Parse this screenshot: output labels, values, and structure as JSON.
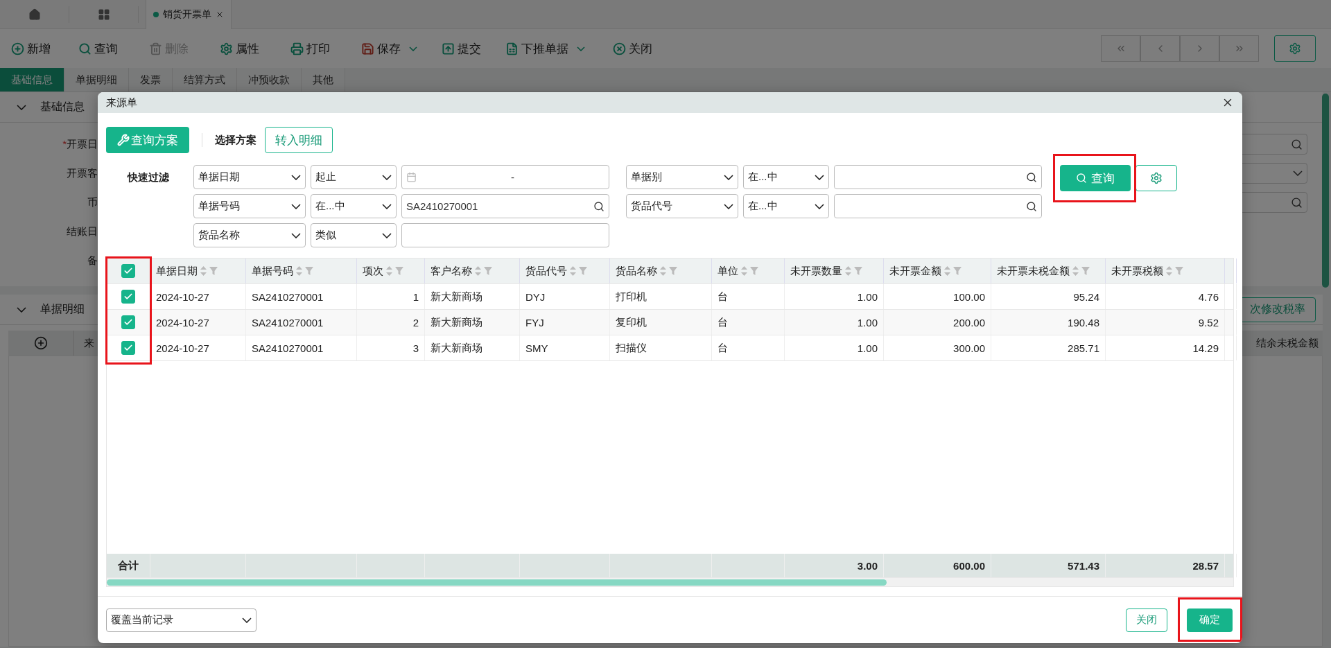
{
  "app_tabs": [
    {
      "label": "销货开票单",
      "selected": true
    }
  ],
  "toolbar": [
    {
      "label": "新增",
      "disabled": false,
      "has_menu": false
    },
    {
      "label": "查询",
      "disabled": false,
      "has_menu": false
    },
    {
      "label": "删除",
      "disabled": true,
      "has_menu": false
    },
    {
      "label": "属性",
      "disabled": false,
      "has_menu": false
    },
    {
      "label": "打印",
      "disabled": false,
      "has_menu": false
    },
    {
      "label": "保存",
      "disabled": false,
      "has_menu": true
    },
    {
      "label": "提交",
      "disabled": false,
      "has_menu": false
    },
    {
      "label": "下推单据",
      "disabled": false,
      "has_menu": true
    },
    {
      "label": "关闭",
      "disabled": false,
      "has_menu": false
    }
  ],
  "form_tabs": [
    {
      "label": "基础信息",
      "selected": true
    },
    {
      "label": "单据明细",
      "selected": false
    },
    {
      "label": "发票",
      "selected": false
    },
    {
      "label": "结算方式",
      "selected": false
    },
    {
      "label": "冲预收款",
      "selected": false
    },
    {
      "label": "其他",
      "selected": false
    }
  ],
  "basic_section": {
    "title": "基础信息",
    "expanded": true,
    "fields": [
      {
        "label": "开票日",
        "marker": "*",
        "kind": "search"
      },
      {
        "label": "开票客",
        "kind": "select"
      },
      {
        "label": "币",
        "kind": "search"
      },
      {
        "label": "结账日",
        "kind": "plain"
      },
      {
        "label": "备",
        "kind": "plain"
      }
    ]
  },
  "detail_section": {
    "title": "单据明细",
    "expanded": true,
    "button": "次修改税率",
    "columns": [
      "来",
      "结余未税金额"
    ]
  },
  "dialog": {
    "title": "来源单",
    "scheme_button": "查询方案",
    "scheme_label": "选择方案",
    "transfer_button": "转入明细",
    "quick_filter_label": "快速过滤",
    "filters": [
      {
        "field": "单据日期",
        "operator": "起止",
        "kind": "date",
        "separator": "-"
      },
      {
        "field": "单据别",
        "operator": "在...中",
        "kind": "search"
      },
      {
        "field": "单据号码",
        "operator": "在...中",
        "kind": "search",
        "value": "SA2410270001"
      },
      {
        "field": "货品代号",
        "operator": "在...中",
        "kind": "search"
      },
      {
        "field": "货品名称",
        "operator": "类似",
        "kind": "text"
      }
    ],
    "query_button": "查询",
    "table": {
      "select_all": true,
      "columns": [
        {
          "label": "单据日期",
          "kind": "text"
        },
        {
          "label": "单据号码",
          "kind": "text"
        },
        {
          "label": "项次",
          "kind": "number"
        },
        {
          "label": "客户名称",
          "kind": "text"
        },
        {
          "label": "货品代号",
          "kind": "text"
        },
        {
          "label": "货品名称",
          "kind": "text"
        },
        {
          "label": "单位",
          "kind": "text"
        },
        {
          "label": "未开票数量",
          "kind": "number",
          "total": "3.00"
        },
        {
          "label": "未开票金额",
          "kind": "number",
          "total": "600.00"
        },
        {
          "label": "未开票未税金额",
          "kind": "number",
          "total": "571.43"
        },
        {
          "label": "未开票税额",
          "kind": "number",
          "total": "28.57"
        }
      ],
      "rows": [
        {
          "checked": true,
          "cells": [
            "2024-10-27",
            "SA2410270001",
            "1",
            "新大新商场",
            "DYJ",
            "打印机",
            "台",
            "1.00",
            "100.00",
            "95.24",
            "4.76"
          ]
        },
        {
          "checked": true,
          "cells": [
            "2024-10-27",
            "SA2410270001",
            "2",
            "新大新商场",
            "FYJ",
            "复印机",
            "台",
            "1.00",
            "200.00",
            "190.48",
            "9.52"
          ]
        },
        {
          "checked": true,
          "cells": [
            "2024-10-27",
            "SA2410270001",
            "3",
            "新大新商场",
            "SMY",
            "扫描仪",
            "台",
            "1.00",
            "300.00",
            "285.71",
            "14.29"
          ]
        }
      ],
      "total_label": "合计"
    },
    "mode_select": "覆盖当前记录",
    "close_button": "关闭",
    "confirm_button": "确定"
  }
}
